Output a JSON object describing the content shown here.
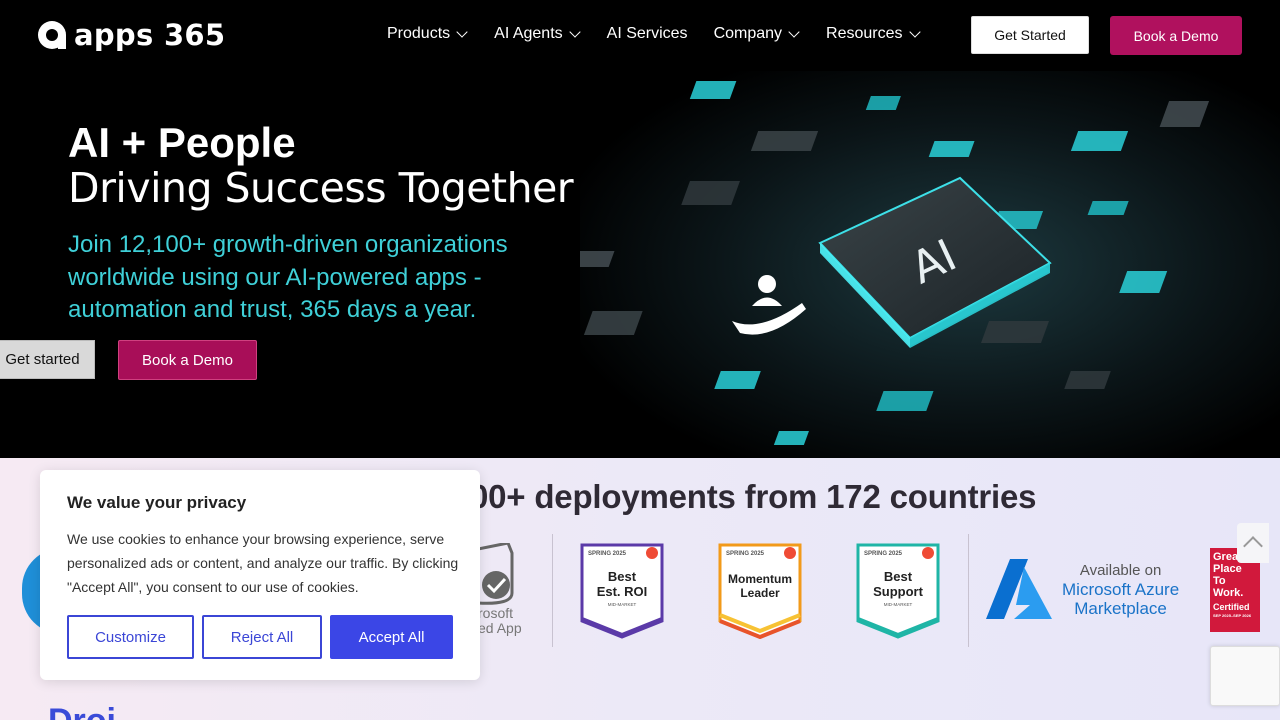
{
  "nav": {
    "logo_text": "apps 365",
    "menu": [
      {
        "label": "Products",
        "dropdown": true
      },
      {
        "label": "AI Agents",
        "dropdown": true
      },
      {
        "label": "AI Services",
        "dropdown": false
      },
      {
        "label": "Company",
        "dropdown": true
      },
      {
        "label": "Resources",
        "dropdown": true
      }
    ],
    "get_started": "Get Started",
    "book_demo": "Book a Demo"
  },
  "hero": {
    "title": "AI + People",
    "subtitle": "Driving Success Together",
    "description": "Join 12,100+ growth-driven organizations worldwide using our AI-powered apps - automation and trust, 365 days a year.",
    "btn_get_started": "Get started",
    "btn_book_demo": "Book a Demo",
    "chip_label": "AI"
  },
  "trust": {
    "heading": "00+ deployments from 172 countries",
    "ms_text_line1": "rosoft",
    "ms_text_line2": "ed App",
    "badges": [
      {
        "season": "SPRING 2025",
        "line1": "Best",
        "line2": "Est. ROI",
        "segment": "MID-MARKET",
        "color": "#5b3aa8"
      },
      {
        "season": "SPRING 2025",
        "line1": "Momentum",
        "line2": "Leader",
        "segment": "",
        "color": "#f29a1a"
      },
      {
        "season": "SPRING 2025",
        "line1": "Best",
        "line2": "Support",
        "segment": "MID-MARKET",
        "color": "#1fb5a6"
      }
    ],
    "azure_line1": "Available on",
    "azure_line2": "Microsoft Azure",
    "azure_line3": "Marketplace",
    "gptw": [
      "Great",
      "Place",
      "To",
      "Work.",
      "Certified"
    ],
    "gptw_date": "SEP 2025–SEP 2026"
  },
  "next_section_heading": "Droi",
  "cookie": {
    "title": "We value your privacy",
    "body": "We use cookies to enhance your browsing experience, serve personalized ads or content, and analyze our traffic. By clicking \"Accept All\", you consent to our use of cookies.",
    "customize": "Customize",
    "reject": "Reject All",
    "accept": "Accept All"
  }
}
